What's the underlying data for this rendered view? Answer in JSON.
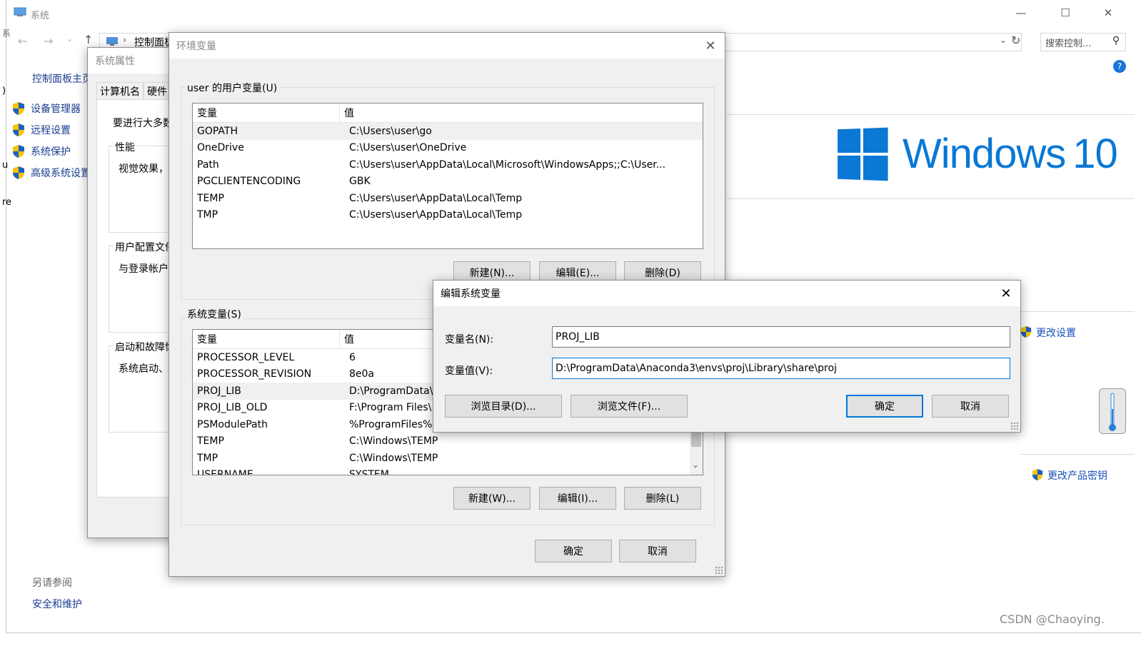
{
  "system_window": {
    "title": "系统",
    "minimize": "—",
    "maximize": "☐",
    "close": "✕",
    "address_crumb": "控制面板",
    "search_placeholder": "搜索控制...",
    "left_fragment_1": "系",
    "left_fragment_2": ")",
    "left_fragment_3": "u",
    "left_fragment_4": "re",
    "sidebar_home": "控制面板主页",
    "sidebar_items": [
      "设备管理器",
      "远程设置",
      "系统保护",
      "高级系统设置"
    ],
    "see_also_title": "另请参阅",
    "see_also_item": "安全和维护",
    "windows_brand": "Windows",
    "windows_version": "10",
    "change_settings": "更改设置",
    "change_product_key": "更改产品密钥",
    "help_badge": "?"
  },
  "system_properties": {
    "title": "系统属性",
    "tabs": [
      "计算机名",
      "硬件"
    ],
    "intro": "要进行大多数",
    "performance_label": "性能",
    "performance_text": "视觉效果，",
    "profile_label": "用户配置文件",
    "profile_text": "与登录帐户",
    "startup_label": "启动和故障恢复",
    "startup_text": "系统启动、"
  },
  "env_dialog": {
    "title": "环境变量",
    "user_section_label": "user 的用户变量(U)",
    "col_var": "变量",
    "col_value": "值",
    "user_vars": [
      {
        "name": "GOPATH",
        "value": "C:\\Users\\user\\go"
      },
      {
        "name": "OneDrive",
        "value": "C:\\Users\\user\\OneDrive"
      },
      {
        "name": "Path",
        "value": "C:\\Users\\user\\AppData\\Local\\Microsoft\\WindowsApps;;C:\\User..."
      },
      {
        "name": "PGCLIENTENCODING",
        "value": "GBK"
      },
      {
        "name": "TEMP",
        "value": "C:\\Users\\user\\AppData\\Local\\Temp"
      },
      {
        "name": "TMP",
        "value": "C:\\Users\\user\\AppData\\Local\\Temp"
      }
    ],
    "user_buttons": {
      "new": "新建(N)...",
      "edit": "编辑(E)...",
      "delete": "删除(D)"
    },
    "system_section_label": "系统变量(S)",
    "system_vars": [
      {
        "name": "PROCESSOR_LEVEL",
        "value": "6"
      },
      {
        "name": "PROCESSOR_REVISION",
        "value": "8e0a"
      },
      {
        "name": "PROJ_LIB",
        "value": "D:\\ProgramData\\"
      },
      {
        "name": "PROJ_LIB_OLD",
        "value": "F:\\Program Files\\"
      },
      {
        "name": "PSModulePath",
        "value": "%ProgramFiles%"
      },
      {
        "name": "TEMP",
        "value": "C:\\Windows\\TEMP"
      },
      {
        "name": "TMP",
        "value": "C:\\Windows\\TEMP"
      },
      {
        "name": "USERNAME",
        "value": "SYSTEM"
      }
    ],
    "system_buttons": {
      "new": "新建(W)...",
      "edit": "编辑(I)...",
      "delete": "删除(L)"
    },
    "ok": "确定",
    "cancel": "取消"
  },
  "edit_dialog": {
    "title": "编辑系统变量",
    "name_label": "变量名(N):",
    "name_value": "PROJ_LIB",
    "value_label": "变量值(V):",
    "value_value": "D:\\ProgramData\\Anaconda3\\envs\\proj\\Library\\share\\proj",
    "browse_dir": "浏览目录(D)...",
    "browse_file": "浏览文件(F)...",
    "ok": "确定",
    "cancel": "取消"
  },
  "watermark": "CSDN @Chaoying."
}
